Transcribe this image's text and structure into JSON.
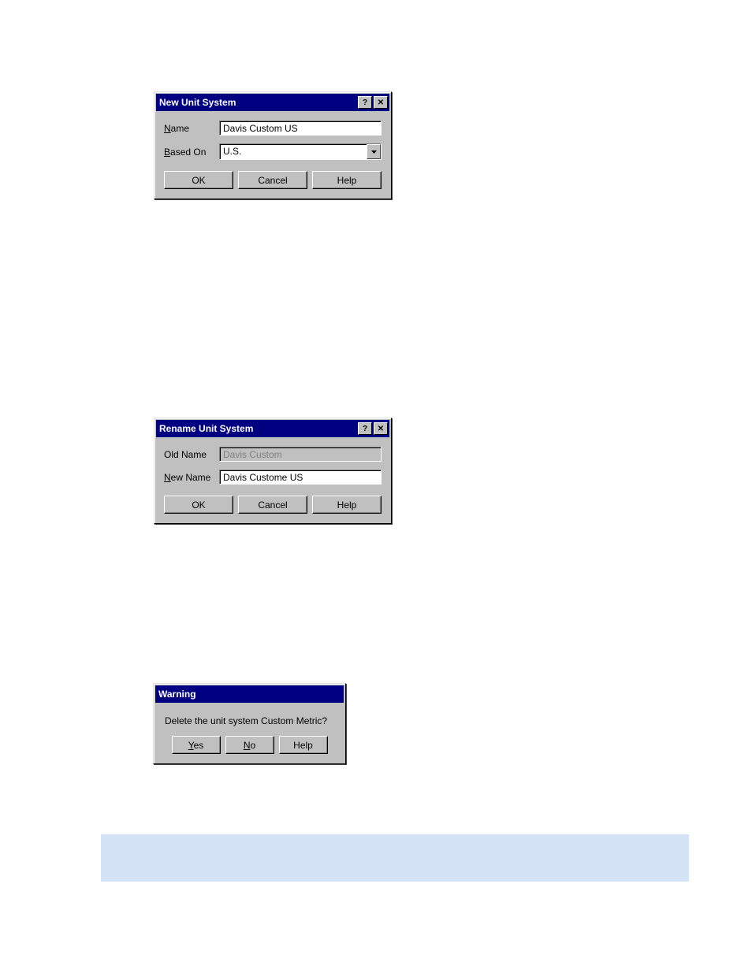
{
  "dialog_new": {
    "title": "New Unit System",
    "name_label": "Name",
    "name_value": "Davis Custom US",
    "based_on_label": "Based On",
    "based_on_value": "U.S.",
    "ok": "OK",
    "cancel": "Cancel",
    "help": "Help"
  },
  "dialog_rename": {
    "title": "Rename Unit System",
    "old_name_label": "Old Name",
    "old_name_value": "Davis Custom",
    "new_name_label": "New Name",
    "new_name_value": "Davis Custome US",
    "ok": "OK",
    "cancel": "Cancel",
    "help": "Help"
  },
  "dialog_warning": {
    "title": "Warning",
    "message": "Delete the unit system Custom Metric?",
    "yes": "Yes",
    "no": "No",
    "help": "Help"
  }
}
